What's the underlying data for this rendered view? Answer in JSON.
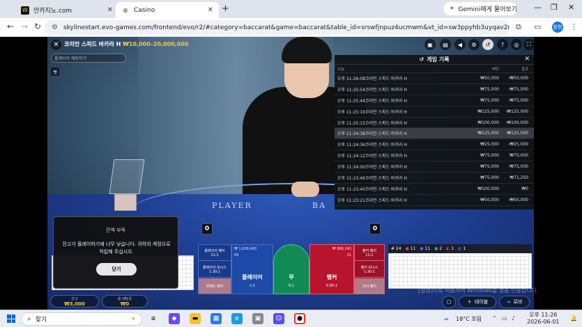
{
  "browser": {
    "tabs": [
      {
        "label": "안카지노.com",
        "close": "✕"
      },
      {
        "label": "Casino",
        "close": "✕"
      }
    ],
    "new_tab": "+",
    "gemini_label": "Gemini에게 물어보기",
    "url": "skylinestart.evo-games.com/frontend/evo/r2/#category=baccarat&game=baccarat&table_id=srswfjnpuz4ucmwm&vt_id=sw3ppyhb3uyqav2r&lobby_launc...",
    "profile_initials": "윤현"
  },
  "game": {
    "table_name": "코리언 스피드 바카라 H",
    "limit": "₩10,000–20,000,000",
    "chat_placeholder": "플레이어 채팅하기",
    "small_label": "벳",
    "felt_player": "PLAYER",
    "felt_banker": "BA",
    "player_count": "0",
    "banker_count": "0",
    "history": {
      "title": "게임 기록",
      "columns": {
        "time": "오늘",
        "game": "",
        "bet": "배팅",
        "payout": "결과"
      },
      "rows": [
        {
          "time": "오후 11:26:08",
          "game": "코리언 스피드 바카라 H",
          "bet": "₩50,000",
          "payout": "-₩50,000"
        },
        {
          "time": "오후 11:25:54",
          "game": "코리언 스피드 바카라 H",
          "bet": "₩75,000",
          "payout": "-₩75,000"
        },
        {
          "time": "오후 11:25:44",
          "game": "코리언 스피드 바카라 H",
          "bet": "₩75,000",
          "payout": "-₩75,000"
        },
        {
          "time": "오후 11:25:19",
          "game": "코리언 스피드 바카라 H",
          "bet": "₩125,000",
          "payout": "-₩125,000"
        },
        {
          "time": "오후 11:25:15",
          "game": "코리언 스피드 바카라 H",
          "bet": "₩100,000",
          "payout": "-₩100,000"
        },
        {
          "time": "오후 11:24:38",
          "game": "코리언 스피드 바카라 H",
          "bet": "₩125,000",
          "payout": "₩125,000",
          "highlight": true
        },
        {
          "time": "오후 11:24:36",
          "game": "코리언 스피드 바카라 H",
          "bet": "₩25,000",
          "payout": "-₩25,000"
        },
        {
          "time": "오후 11:24:12",
          "game": "코리언 스피드 바카라 H",
          "bet": "₩75,000",
          "payout": "₩75,000"
        },
        {
          "time": "오후 11:24:00",
          "game": "코리언 스피드 바카라 H",
          "bet": "₩75,000",
          "payout": "-₩75,000"
        },
        {
          "time": "오후 11:23:46",
          "game": "코리언 스피드 바카라 H",
          "bet": "₩75,000",
          "payout": "₩71,250"
        },
        {
          "time": "오후 11:23:40",
          "game": "코리언 스피드 바카라 H",
          "bet": "₩100,000",
          "payout": "₩0"
        },
        {
          "time": "오후 11:23:21",
          "game": "코리언 스피드 바카라 H",
          "bet": "₩50,000",
          "payout": "-₩50,000"
        }
      ]
    },
    "betting": {
      "player_pair": "플레이어 페어",
      "player_pair_odds": "11:1",
      "player_bonus": "플레이어 보너스",
      "player_bonus_odds": "1:30:1",
      "perfect_pair": "퍼펙트 페어",
      "player": "플레이어",
      "player_odds": "1:1",
      "player_total": "₩ 1,658,400",
      "player_count": "84",
      "tie": "무",
      "tie_odds": "8:1",
      "banker": "뱅커",
      "banker_odds": "0.95:1",
      "banker_total": "₩ 888,240",
      "banker_count": "21",
      "banker_pair": "뱅커 페어",
      "banker_pair_odds": "11:1",
      "banker_bonus": "뱅커 보너스",
      "banker_bonus_odds": "1:30:1",
      "either_pair": "이더 페어"
    },
    "road_stats": {
      "round": "# 24",
      "banker": "11",
      "player": "11",
      "tie": "2",
      "bpair": "1",
      "ppair": "1"
    },
    "dialog": {
      "title": "잔액 부족",
      "message": "잔고가 플레이하기에 너무 낮습니다. 귀하의 계정으로 적립해 주십시오.",
      "button": "닫기"
    },
    "balance": {
      "label": "잔고",
      "value": "₩3,000"
    },
    "total_bet": {
      "label": "총 배팅금",
      "value": "₩0"
    },
    "table_button": "테이블",
    "lobby_button": "로비",
    "watermark1": "Windows 정품 인증",
    "watermark2": "[설정]으로 이동하여 Windows를 정품 인증합니다."
  },
  "taskbar": {
    "search": "찾기",
    "weather": "18°C 흐림",
    "time": "오후 11:26",
    "date": "2026-06-01"
  }
}
